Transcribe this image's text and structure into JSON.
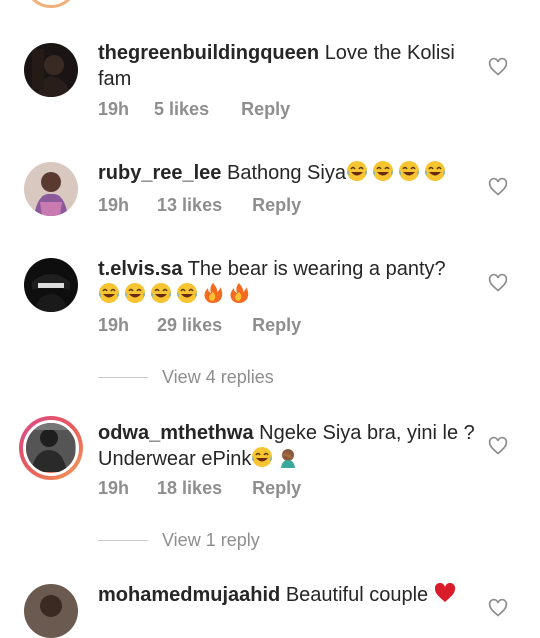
{
  "comments": [
    {
      "username": "thegreenbuildingqueen",
      "text": "Love the Kolisi fam",
      "emojis": [],
      "time": "19h",
      "likes": "5 likes",
      "reply": "Reply"
    },
    {
      "username": "ruby_ree_lee",
      "text": "Bathong Siya",
      "emojis": [
        "laughing-tears",
        "laughing-tears",
        "laughing-tears",
        "laughing-tears"
      ],
      "time": "19h",
      "likes": "13 likes",
      "reply": "Reply"
    },
    {
      "username": "t.elvis.sa",
      "text": "The bear is wearing a panty?",
      "emojis": [
        "laughing-tears",
        "laughing-tears",
        "laughing-tears",
        "laughing-tears",
        "fire",
        "fire"
      ],
      "time": "19h",
      "likes": "29 likes",
      "reply": "Reply",
      "view_replies": "View 4 replies"
    },
    {
      "username": "odwa_mthethwa",
      "text": "Ngeke Siya bra, yini le ? Underwear ePink",
      "emojis": [
        "laughing-tears",
        "facepalm"
      ],
      "time": "19h",
      "likes": "18 likes",
      "reply": "Reply",
      "view_replies": "View 1 reply"
    },
    {
      "username": "mohamedmujaahid",
      "text": "Beautiful couple",
      "emojis": [
        "red-heart"
      ]
    }
  ],
  "colors": {
    "text": "#262626",
    "muted": "#8e8e8e",
    "story_ring": "#d94a8c"
  }
}
